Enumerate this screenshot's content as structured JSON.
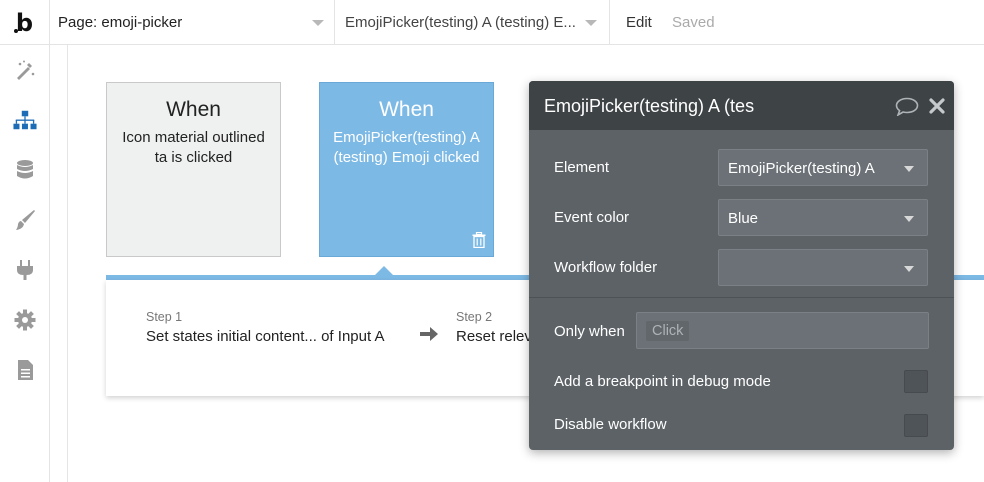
{
  "topbar": {
    "logo": "b",
    "page_select": "Page: emoji-picker",
    "element_select": "EmojiPicker(testing) A (testing) E...",
    "edit": "Edit",
    "saved": "Saved"
  },
  "sidebar": {
    "items": [
      {
        "icon": "design-icon"
      },
      {
        "icon": "workflow-icon"
      },
      {
        "icon": "data-icon"
      },
      {
        "icon": "styles-icon"
      },
      {
        "icon": "plugins-icon"
      },
      {
        "icon": "settings-icon"
      },
      {
        "icon": "logs-icon"
      }
    ],
    "active_index": 1,
    "accent_color": "#1c6cb6"
  },
  "events": [
    {
      "title": "When",
      "description": "Icon material outlined ta is clicked",
      "selected": false
    },
    {
      "title": "When",
      "description": "EmojiPicker(testing) A (testing) Emoji clicked",
      "selected": true
    }
  ],
  "steps": [
    {
      "num": "Step 1",
      "text": "Set states initial content... of Input A"
    },
    {
      "num": "Step 2",
      "text": "Reset relev"
    }
  ],
  "panel": {
    "title": "EmojiPicker(testing) A (tes",
    "element_label": "Element",
    "element_value": "EmojiPicker(testing) A",
    "event_color_label": "Event color",
    "event_color_value": "Blue",
    "workflow_folder_label": "Workflow folder",
    "workflow_folder_value": "",
    "only_when_label": "Only when",
    "only_when_placeholder": "Click",
    "breakpoint_label": "Add a breakpoint in debug mode",
    "breakpoint_checked": false,
    "disable_label": "Disable workflow",
    "disable_checked": false
  },
  "colors": {
    "selected_card": "#7db9e5",
    "panel_bg": "#5d6266",
    "panel_header": "#3e4346"
  }
}
